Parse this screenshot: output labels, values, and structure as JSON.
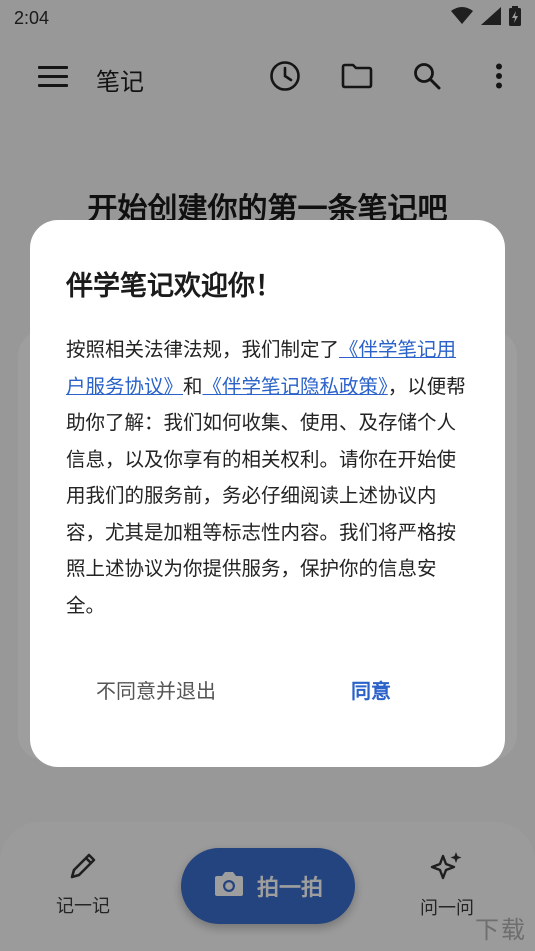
{
  "status_bar": {
    "time": "2:04"
  },
  "app_bar": {
    "title": "笔记"
  },
  "main": {
    "empty_title": "开始创建你的第一条笔记吧"
  },
  "bottom_nav": {
    "note_label": "记一记",
    "camera_label": "拍一拍",
    "ask_label": "问一问"
  },
  "dialog": {
    "title": "伴学笔记欢迎你！",
    "body_part1": "按照相关法律法规，我们制定了",
    "link_agreement": "《伴学笔记用户服务协议》",
    "body_and": "和",
    "link_privacy": "《伴学笔记隐私政策》",
    "body_part2": "，以便帮助你了解：我们如何收集、使用、及存储个人信息，以及你享有的相关权利。请你在开始使用我们的服务前，务必仔细阅读上述协议内容，尤其是加粗等标志性内容。我们将严格按照上述协议为你提供服务，保护你的信息安全。",
    "disagree_label": "不同意并退出",
    "agree_label": "同意"
  },
  "watermark": {
    "text": "下载"
  },
  "colors": {
    "accent": "#2a62c9",
    "fab": "#3a6fcf",
    "scrim": "rgba(0,0,0,0.38)"
  }
}
